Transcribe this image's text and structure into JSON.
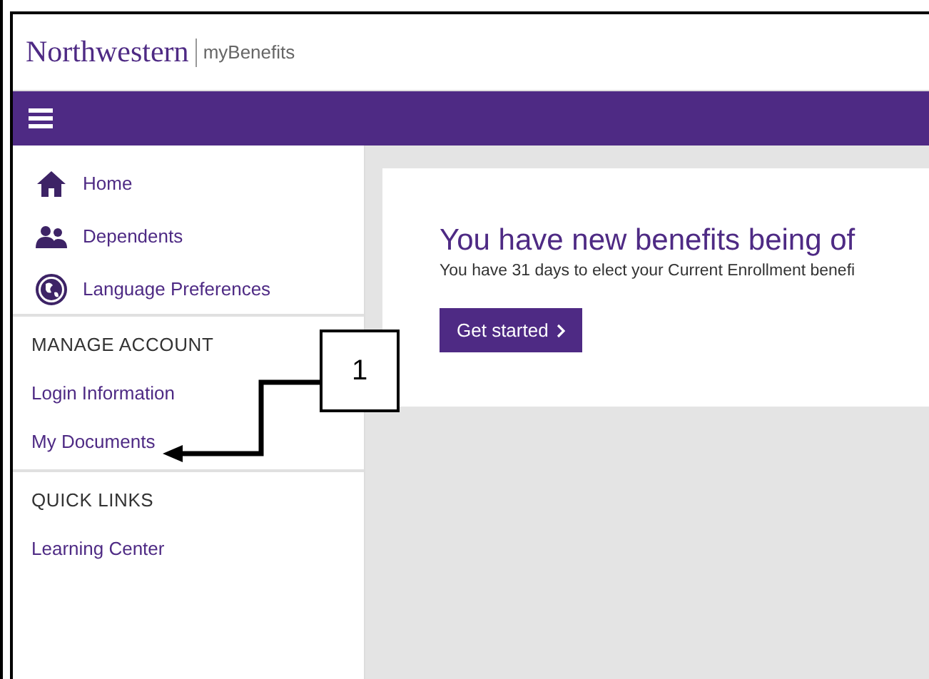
{
  "header": {
    "brand": "Northwestern",
    "product": "myBenefits"
  },
  "sidebar": {
    "items": [
      {
        "label": "Home"
      },
      {
        "label": "Dependents"
      },
      {
        "label": "Language Preferences"
      }
    ],
    "sections": [
      {
        "heading": "MANAGE ACCOUNT",
        "links": [
          "Login Information",
          "My Documents"
        ]
      },
      {
        "heading": "QUICK LINKS",
        "links": [
          "Learning Center"
        ]
      }
    ]
  },
  "banner": {
    "title": "You have new benefits being of",
    "text": "You have 31 days to elect your Current Enrollment benefi",
    "button": "Get started"
  },
  "annotation": {
    "label": "1"
  }
}
